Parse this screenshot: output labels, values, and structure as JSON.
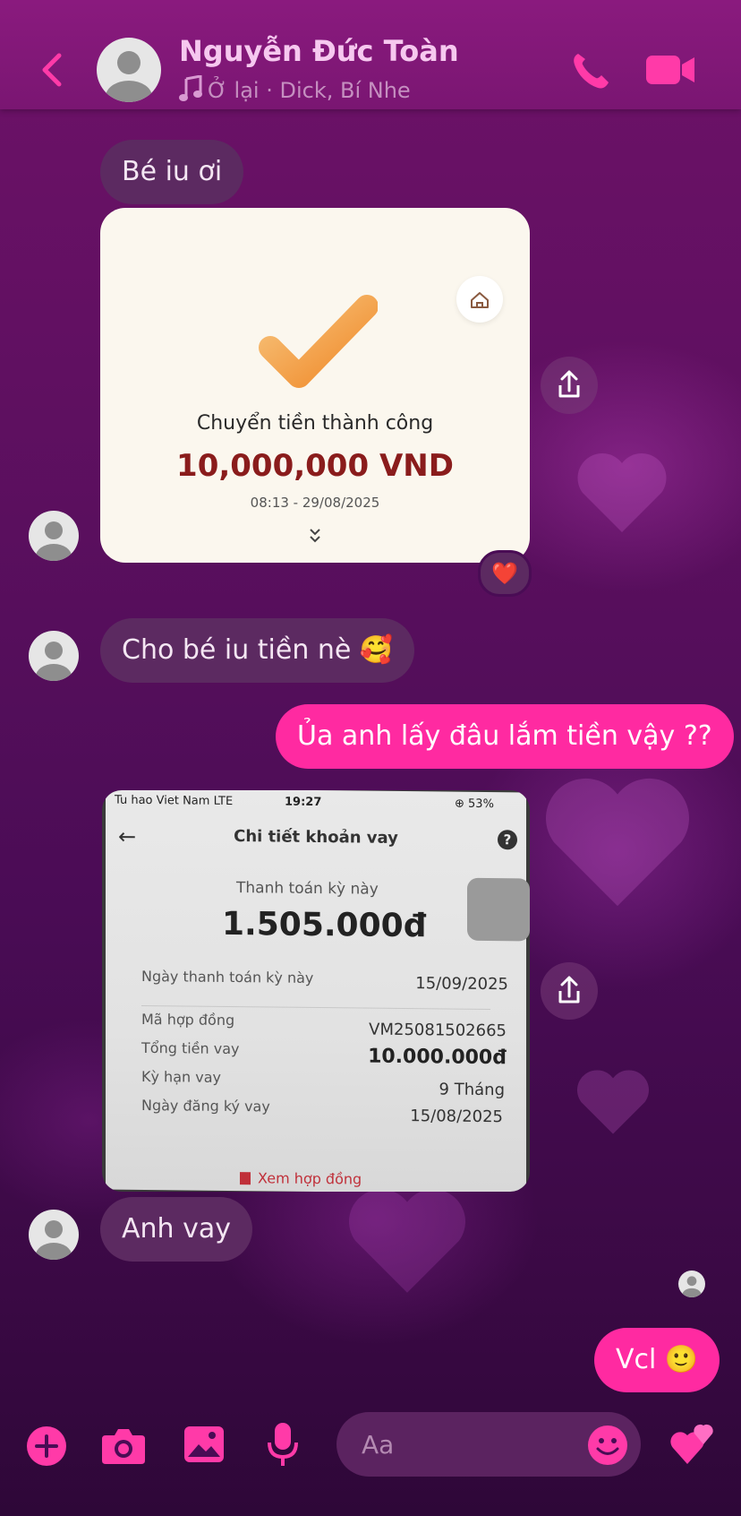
{
  "header": {
    "contact_name": "Nguyễn Đức Toàn",
    "music_note_icon": "music-note-icon",
    "now_playing": "Ở lại · Dick, Bí Nhe"
  },
  "messages": {
    "m1": "Bé iu ơi",
    "m2": "Cho bé iu tiền nè 🥰",
    "m3": "Ủa anh lấy đâu lắm tiền vậy ??",
    "m4": "Anh vay",
    "m5": "Vcl 🙂"
  },
  "transfer_card": {
    "title": "Chuyển tiền thành công",
    "amount": "10,000,000 VND",
    "time": "08:13 - 29/08/2025",
    "reaction": "❤️"
  },
  "loan_photo": {
    "carrier": "Tu hao Viet Nam  LTE",
    "clock": "19:27",
    "battery": "⊕ 53%",
    "screen_title": "Chi tiết khoản vay",
    "payment_label": "Thanh toán kỳ này",
    "payment_amount": "1.505.000đ",
    "rows": [
      {
        "label": "Ngày thanh toán kỳ này",
        "value": "15/09/2025"
      },
      {
        "label": "Mã hợp đồng",
        "value": "VM25081502665"
      },
      {
        "label": "Tổng tiền vay",
        "value": "10.000.000đ"
      },
      {
        "label": "Kỳ hạn vay",
        "value": "9 Tháng"
      },
      {
        "label": "Ngày đăng ký vay",
        "value": "15/08/2025"
      }
    ],
    "contract_link": "Xem hợp đồng"
  },
  "composer": {
    "placeholder": "Aa"
  },
  "colors": {
    "header_bg": "#8a1a7e",
    "incoming_bubble": "#5c2a61",
    "outgoing_bubble": "#ff2aa1",
    "accent": "#ff2aa1"
  }
}
